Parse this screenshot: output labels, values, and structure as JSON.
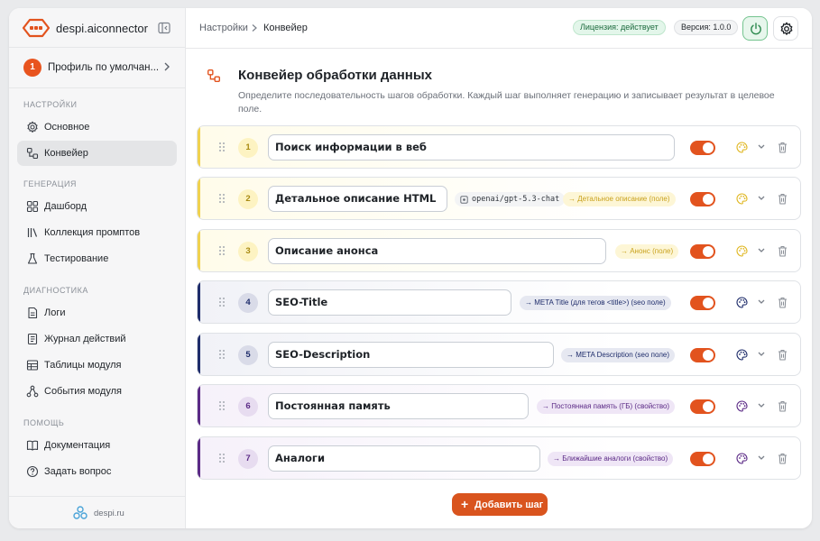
{
  "brand": {
    "name": "despi.aiconnector"
  },
  "profile": {
    "badge": "1",
    "name": "Профиль по умолчан..."
  },
  "sidebar": {
    "sections": [
      {
        "label": "НАСТРОЙКИ",
        "items": [
          {
            "label": "Основное",
            "icon": "gear-icon"
          },
          {
            "label": "Конвейер",
            "icon": "pipeline-icon",
            "active": true
          }
        ]
      },
      {
        "label": "ГЕНЕРАЦИЯ",
        "items": [
          {
            "label": "Дашборд",
            "icon": "grid-icon"
          },
          {
            "label": "Коллекция промптов",
            "icon": "library-icon"
          },
          {
            "label": "Тестирование",
            "icon": "flask-icon"
          }
        ]
      },
      {
        "label": "ДИАГНОСТИКА",
        "items": [
          {
            "label": "Логи",
            "icon": "log-icon"
          },
          {
            "label": "Журнал действий",
            "icon": "journal-icon"
          },
          {
            "label": "Таблицы модуля",
            "icon": "table-icon"
          },
          {
            "label": "События модуля",
            "icon": "events-icon"
          }
        ]
      },
      {
        "label": "ПОМОЩЬ",
        "items": [
          {
            "label": "Документация",
            "icon": "book-icon"
          },
          {
            "label": "Задать вопрос",
            "icon": "question-icon"
          }
        ]
      }
    ],
    "footer": "despi.ru"
  },
  "header": {
    "breadcrumb": [
      "Настройки",
      "Конвейер"
    ],
    "license": "Лицензия: действует",
    "version": "Версия: 1.0.0"
  },
  "main": {
    "title": "Конвейер обработки данных",
    "description": "Определите последовательность шагов обработки. Каждый шаг выполняет генерацию и записывает результат в целевое поле.",
    "add_button": "Добавить шаг"
  },
  "steps": [
    {
      "num": "1",
      "name": "Поиск информации в веб",
      "model": "",
      "target": "",
      "enabled": true
    },
    {
      "num": "2",
      "name": "Детальное описание HTML",
      "model": "openai/gpt-5.3-chat",
      "target": "→ Детальное описание (поле)",
      "enabled": true
    },
    {
      "num": "3",
      "name": "Описание анонса",
      "model": "",
      "target": "→ Анонс (поле)",
      "enabled": true
    },
    {
      "num": "4",
      "name": "SEO-Title",
      "model": "",
      "target": "→ META Title (для тегов <title>) (seo поле)",
      "enabled": true
    },
    {
      "num": "5",
      "name": "SEO-Description",
      "model": "",
      "target": "→ META Description (seo поле)",
      "enabled": true
    },
    {
      "num": "6",
      "name": "Постоянная память",
      "model": "",
      "target": "→ Постоянная память (ГБ) (свойство)",
      "enabled": true
    },
    {
      "num": "7",
      "name": "Аналоги",
      "model": "",
      "target": "→ Ближайшие аналоги (свойство)",
      "enabled": true
    }
  ],
  "colors": {
    "accent": "#e2531e",
    "yellow": "#f2d96a",
    "navy": "#1f2d6b",
    "purple": "#5b2a86"
  }
}
